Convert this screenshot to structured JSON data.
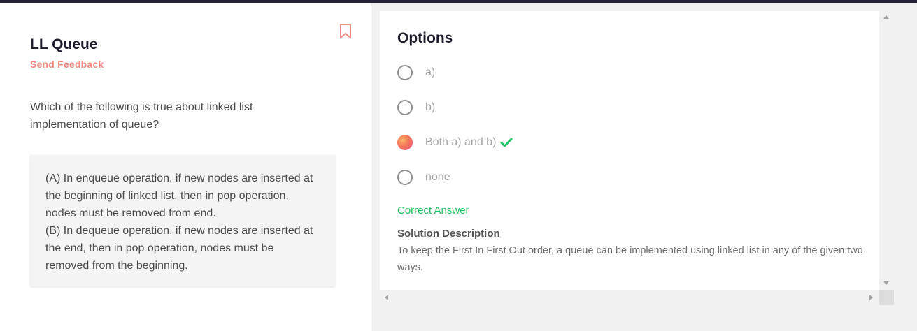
{
  "question_panel": {
    "title": "LL Queue",
    "feedback_link": "Send Feedback",
    "question_text": "Which of the following is true about linked list implementation of queue?",
    "statement_a": "(A) In enqueue operation, if new nodes are inserted at the beginning of linked list, then in pop operation, nodes must be removed from end.",
    "statement_b": "(B) In dequeue operation, if new nodes are inserted at the end, then in pop operation, nodes must be removed from the beginning.",
    "bookmark_icon": "bookmark-icon"
  },
  "options_panel": {
    "title": "Options",
    "options": [
      {
        "label": "a)",
        "selected": false
      },
      {
        "label": "b)",
        "selected": false
      },
      {
        "label": "Both a) and b)",
        "selected": true,
        "correct": true
      },
      {
        "label": "none",
        "selected": false
      }
    ],
    "result_text": "Correct Answer",
    "solution_title": "Solution Description",
    "solution_text": "To keep the First In First Out order, a queue can be implemented using linked list in any of the given two ways."
  },
  "colors": {
    "accent_feedback": "#f28b82",
    "correct_green": "#1ec15f",
    "topbar": "#25233a"
  }
}
